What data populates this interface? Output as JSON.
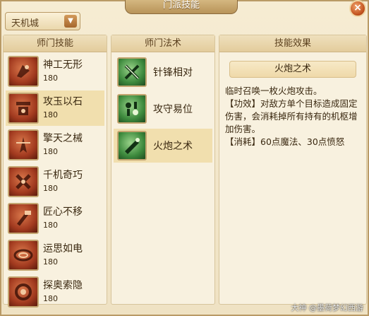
{
  "window": {
    "title": "门派技能",
    "close_label": "×"
  },
  "dropdown": {
    "value": "天机城",
    "arrow": "▼"
  },
  "skills_panel": {
    "header": "师门技能",
    "items": [
      {
        "name": "神工无形",
        "level": "180"
      },
      {
        "name": "攻玉以石",
        "level": "180"
      },
      {
        "name": "擎天之械",
        "level": "180"
      },
      {
        "name": "千机奇巧",
        "level": "180"
      },
      {
        "name": "匠心不移",
        "level": "180"
      },
      {
        "name": "运思如电",
        "level": "180"
      },
      {
        "name": "探奥索隐",
        "level": "180"
      }
    ],
    "selected_index": 1
  },
  "spells_panel": {
    "header": "师门法术",
    "items": [
      {
        "name": "针锋相对"
      },
      {
        "name": "攻守易位"
      },
      {
        "name": "火炮之术"
      }
    ],
    "selected_index": 2
  },
  "effect_panel": {
    "header": "技能效果",
    "title": "火炮之术",
    "lines": [
      "临时召唤一枚火炮攻击。",
      "【功效】对敌方单个目标造成固定伤害，会消耗掉所有持有的机枢增加伤害。",
      "【消耗】60点魔法、30点愤怒"
    ]
  },
  "watermark": "大神 @墨荷梦幻西游",
  "colors": {
    "accent": "#b99a66",
    "selected": "#f1dfae",
    "text": "#3a2810"
  }
}
